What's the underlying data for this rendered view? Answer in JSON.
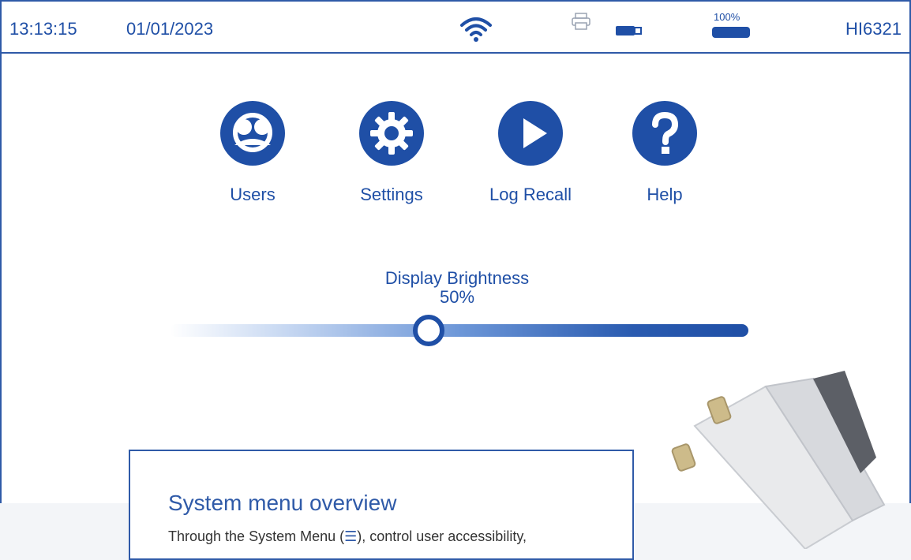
{
  "statusbar": {
    "time": "13:13:15",
    "date": "01/01/2023",
    "battery_percent": "100%",
    "model": "HI6321",
    "icons": [
      "wifi-icon",
      "printer-icon",
      "usb-icon",
      "battery-icon"
    ]
  },
  "menu": {
    "items": [
      {
        "label": "Users",
        "icon": "users-icon"
      },
      {
        "label": "Settings",
        "icon": "gear-icon"
      },
      {
        "label": "Log Recall",
        "icon": "play-icon"
      },
      {
        "label": "Help",
        "icon": "help-icon"
      }
    ]
  },
  "brightness": {
    "title": "Display Brightness",
    "value_label": "50%",
    "level": 0.5
  },
  "card": {
    "heading": "System menu overview",
    "body_prefix": "Through the System Menu (",
    "menu_glyph": "☰",
    "body_suffix": "), control user accessibility,"
  },
  "colors": {
    "accent": "#1f4fa6",
    "border": "#2f5aa8"
  }
}
